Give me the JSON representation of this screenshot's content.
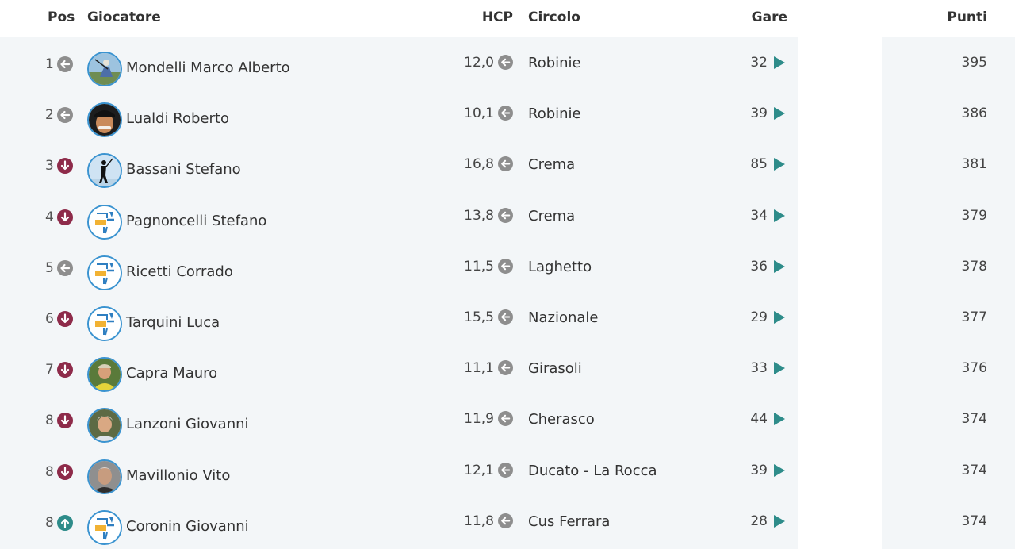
{
  "headers": {
    "pos": "Pos",
    "player": "Giocatore",
    "hcp": "HCP",
    "club": "Circolo",
    "games": "Gare",
    "points": "Punti"
  },
  "colors": {
    "same": "#8e8e8e",
    "down": "#8e2b4a",
    "up": "#2e8c8a",
    "play": "#2e8c8a",
    "avatar_border": "#3a93d0"
  },
  "rows": [
    {
      "pos": "1",
      "trend": "same",
      "avatar": "photo-golf-swing",
      "name": "Mondelli Marco Alberto",
      "hcp": "12,0",
      "club": "Robinie",
      "games": "32",
      "points": "395"
    },
    {
      "pos": "2",
      "trend": "same",
      "avatar": "photo-man-cap",
      "name": "Lualdi Roberto",
      "hcp": "10,1",
      "club": "Robinie",
      "games": "39",
      "points": "386"
    },
    {
      "pos": "3",
      "trend": "down",
      "avatar": "photo-golfer-silhouette",
      "name": "Bassani Stefano",
      "hcp": "16,8",
      "club": "Crema",
      "games": "85",
      "points": "381"
    },
    {
      "pos": "4",
      "trend": "down",
      "avatar": "wegolfers-logo",
      "name": "Pagnoncelli Stefano",
      "hcp": "13,8",
      "club": "Crema",
      "games": "34",
      "points": "379"
    },
    {
      "pos": "5",
      "trend": "same",
      "avatar": "wegolfers-logo",
      "name": "Ricetti Corrado",
      "hcp": "11,5",
      "club": "Laghetto",
      "games": "36",
      "points": "378"
    },
    {
      "pos": "6",
      "trend": "down",
      "avatar": "wegolfers-logo",
      "name": "Tarquini Luca",
      "hcp": "15,5",
      "club": "Nazionale",
      "games": "29",
      "points": "377"
    },
    {
      "pos": "7",
      "trend": "down",
      "avatar": "photo-man-yellow",
      "name": "Capra Mauro",
      "hcp": "11,1",
      "club": "Girasoli",
      "games": "33",
      "points": "376"
    },
    {
      "pos": "8",
      "trend": "down",
      "avatar": "photo-man-grey-hair",
      "name": "Lanzoni Giovanni",
      "hcp": "11,9",
      "club": "Cherasco",
      "games": "44",
      "points": "374"
    },
    {
      "pos": "8",
      "trend": "down",
      "avatar": "photo-man-grey",
      "name": "Mavillonio Vito",
      "hcp": "12,1",
      "club": "Ducato - La Rocca",
      "games": "39",
      "points": "374"
    },
    {
      "pos": "8",
      "trend": "up",
      "avatar": "wegolfers-logo",
      "name": "Coronin Giovanni",
      "hcp": "11,8",
      "club": "Cus Ferrara",
      "games": "28",
      "points": "374"
    }
  ]
}
